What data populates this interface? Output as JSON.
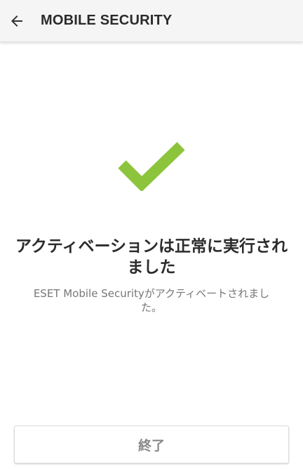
{
  "app_bar": {
    "back_icon": "arrow-left-icon",
    "title": "MOBILE SECURITY"
  },
  "status": {
    "icon": "checkmark-icon",
    "icon_color": "#8cc43c",
    "headline": "アクティベーションは正常に実行されました",
    "message": "ESET Mobile Securityがアクティベートされました。"
  },
  "footer": {
    "finish_label": "終了"
  },
  "colors": {
    "app_bar_bg": "#f5f5f5",
    "title_text": "#2b2b2b",
    "headline_text": "#2c2c2c",
    "message_text": "#777777",
    "button_text": "#888888"
  }
}
